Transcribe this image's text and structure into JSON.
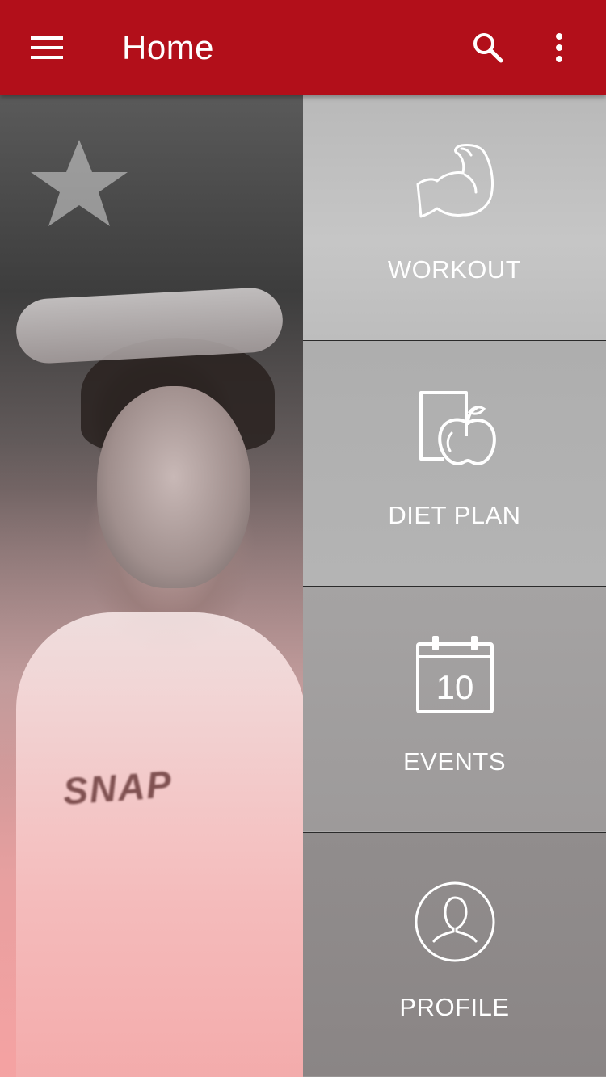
{
  "appbar": {
    "title": "Home",
    "menu_icon": "hamburger-menu-icon",
    "search_icon": "search-icon",
    "more_icon": "more-vert-icon",
    "background_color": "#b20f1a"
  },
  "hero": {
    "shirt_text": "SNAP"
  },
  "menu": {
    "items": [
      {
        "label": "WORKOUT",
        "icon": "flexed-biceps-icon"
      },
      {
        "label": "DIET PLAN",
        "icon": "diet-apple-icon"
      },
      {
        "label": "EVENTS",
        "icon": "calendar-icon",
        "calendar_day": "10"
      },
      {
        "label": "PROFILE",
        "icon": "profile-user-icon"
      }
    ]
  }
}
